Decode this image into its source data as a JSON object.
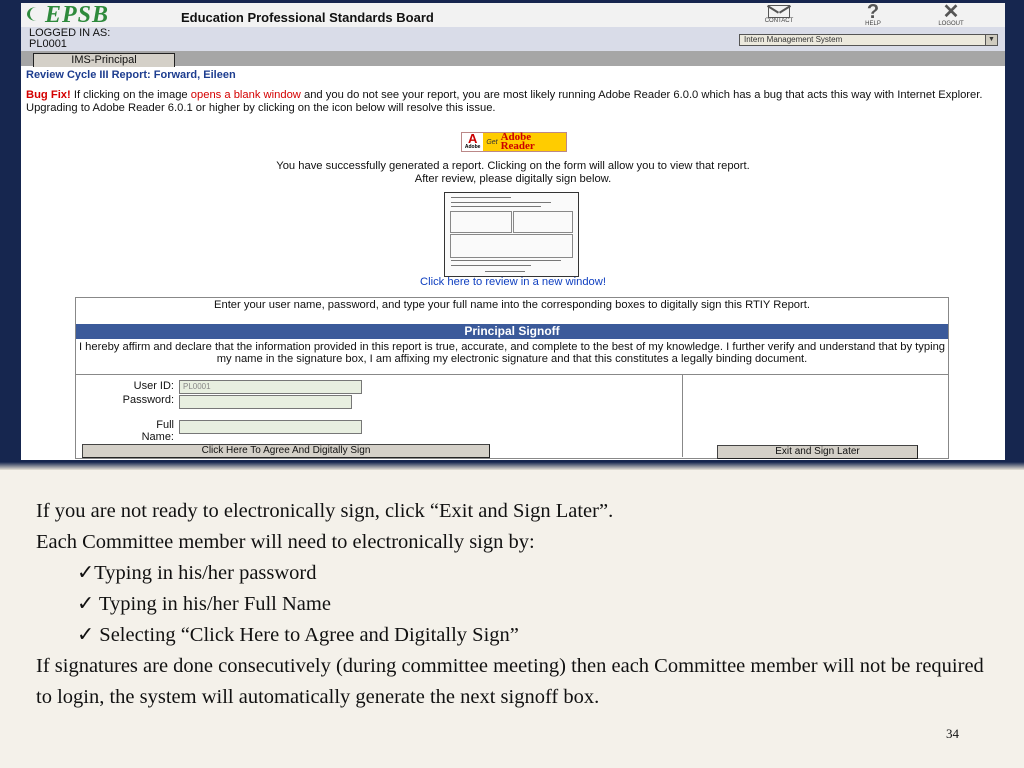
{
  "header": {
    "logo": "EPSB",
    "org_name": "Education Professional Standards Board",
    "icons": [
      {
        "label": "CONTACT",
        "icon": "envelope-icon"
      },
      {
        "label": "HELP",
        "icon": "question-icon"
      },
      {
        "label": "LOGOUT",
        "icon": "x-icon"
      }
    ]
  },
  "login": {
    "label": "LOGGED IN AS:",
    "user": "PL0001",
    "system_select": "Intern Management System"
  },
  "tab": "IMS-Principal",
  "page_title": "Review Cycle III Report: Forward, Eileen",
  "bugfix": {
    "label": "Bug Fix!",
    "text1": "If clicking on the image",
    "highlight": "opens a blank window",
    "text2": "and you do not see your report, you are most likely running Adobe Reader 6.0.0 which has a bug that acts this way with Internet Explorer. Upgrading to Adobe Reader 6.0.1 or higher by clicking on the icon below will resolve this issue."
  },
  "adobe_badge": {
    "brand": "Adobe",
    "get": "Get",
    "product": "Adobe Reader"
  },
  "success_line1": "You have successfully generated a report. Clicking on the form will allow you to view that report.",
  "success_line2": "After review, please digitally sign below.",
  "review_link": "Click here to review in a new window!",
  "form": {
    "instructions": "Enter your user name, password, and type your full name into the corresponding boxes to digitally sign this RTIY Report.",
    "heading": "Principal Signoff",
    "affirmation": "I hereby affirm and declare that the information provided in this report is true, accurate, and complete to the best of my knowledge. I further verify and understand that by typing my name in the signature box, I am affixing my electronic signature and that this constitutes a legally binding document.",
    "user_id_label": "User ID:",
    "user_id_value": "PL0001",
    "password_label": "Password:",
    "password_value": "",
    "fullname_label_1": "Full",
    "fullname_label_2": "Name:",
    "fullname_value": "",
    "sign_button": "Click Here To Agree And Digitally Sign",
    "exit_button": "Exit and Sign Later"
  },
  "caption": {
    "line1": "If you are not ready to electronically sign, click “Exit and Sign Later”.",
    "line2": "Each Committee member will need to electronically sign by:",
    "bullets": [
      "✓Typing in his/her password",
      "✓ Typing in his/her Full Name",
      "✓ Selecting “Click Here to Agree and Digitally Sign”"
    ],
    "line3": "If signatures are done consecutively (during committee meeting) then each Committee member will not be required to login, the system will automatically generate the next signoff box."
  },
  "page_number": "34"
}
